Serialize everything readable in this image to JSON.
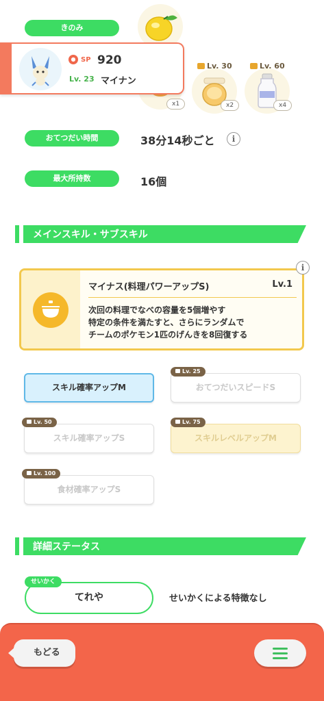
{
  "berry": {
    "label": "きのみ",
    "icon": "lemon-berry-icon"
  },
  "pokemon": {
    "sp_label": "SP",
    "sp_value": "920",
    "level": "Lv. 23",
    "name": "マイナン"
  },
  "ingredients": [
    {
      "level": "",
      "count": "x1",
      "icon": "ingredient-icon"
    },
    {
      "level": "Lv. 30",
      "count": "x2",
      "icon": "honey-jar-icon"
    },
    {
      "level": "Lv. 60",
      "count": "x4",
      "icon": "milk-bottle-icon"
    }
  ],
  "help_time": {
    "label": "おてつだい時間",
    "value": "38分14秒ごと"
  },
  "max_carry": {
    "label": "最大所持数",
    "value": "16個"
  },
  "skills_section": {
    "title": "メインスキル・サブスキル"
  },
  "main_skill": {
    "name": "マイナス(料理パワーアップS)",
    "level": "Lv.1",
    "desc_line1": "次回の料理でなべの容量を5個増やす",
    "desc_line2": "特定の条件を満たすと、さらにランダムで",
    "desc_line3": "チームのポケモン1匹のげんきを8回復する"
  },
  "sub_skills": [
    {
      "name": "スキル確率アップM",
      "unlock": ""
    },
    {
      "name": "おてつだいスピードS",
      "unlock": "Lv. 25"
    },
    {
      "name": "スキル確率アップS",
      "unlock": "Lv. 50"
    },
    {
      "name": "スキルレベルアップM",
      "unlock": "Lv. 75"
    },
    {
      "name": "食材確率アップS",
      "unlock": "Lv. 100"
    }
  ],
  "details_section": {
    "title": "詳細ステータス"
  },
  "nature": {
    "tag": "せいかく",
    "value": "てれや",
    "description": "せいかくによる特徴なし"
  },
  "nav": {
    "back": "もどる"
  },
  "colors": {
    "green": "#3ddc63",
    "coral": "#f3654a",
    "gold": "#f2c84d",
    "sky": "#5fb8e7"
  }
}
